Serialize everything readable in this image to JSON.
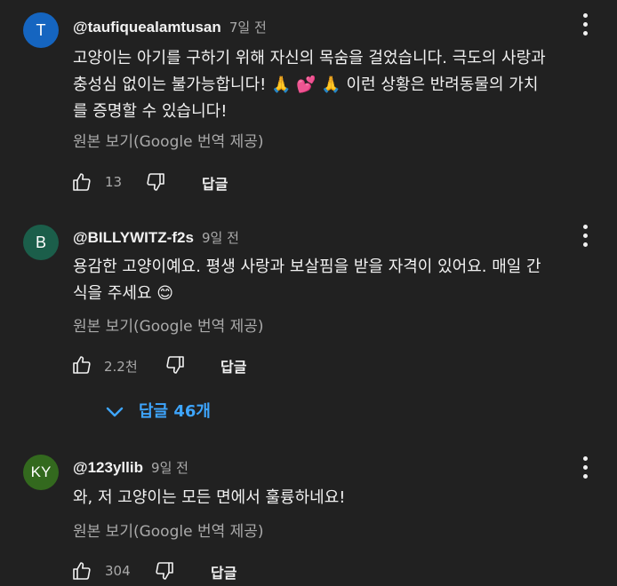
{
  "colors": {
    "background": "#212121",
    "text_primary": "#f1f1f1",
    "text_secondary": "#aaaaaa",
    "link_blue": "#3ea6ff"
  },
  "comments": [
    {
      "avatar_letter": "T",
      "avatar_color": "#1565c0",
      "handle": "@taufiquealamtusan",
      "time": "7일 전",
      "text_lines": [
        "고양이는 아기를 구하기 위해 자신의 목숨을 걸었습니다. 극도의 사랑과",
        "충성심 없이는 불가능합니다! 🙏 💕 🙏  이런 상황은 반려동물의 가치",
        "를 증명할 수 있습니다!"
      ],
      "translate_label": "원본 보기(Google 번역 제공)",
      "like_count": "13",
      "reply_label": "답글",
      "like_icon": "thumbs-up-icon",
      "dislike_icon": "thumbs-down-icon",
      "menu_icon": "more-vert-icon"
    },
    {
      "avatar_letter": "B",
      "avatar_color": "#1b5e4a",
      "handle": "@BILLYWITZ-f2s",
      "time": "9일 전",
      "text_lines": [
        "용감한 고양이예요. 평생 사랑과 보살핌을 받을 자격이 있어요. 매일 간",
        "식을 주세요 😊"
      ],
      "translate_label": "원본 보기(Google 번역 제공)",
      "like_count": "2.2천",
      "reply_label": "답글",
      "like_icon": "thumbs-up-icon",
      "dislike_icon": "thumbs-down-icon",
      "menu_icon": "more-vert-icon",
      "replies_toggle": "답글 46개"
    },
    {
      "avatar_letter": "KY",
      "avatar_color": "#33691e",
      "handle": "@123yllib",
      "time": "9일 전",
      "text_lines": [
        "와, 저 고양이는 모든 면에서 훌륭하네요!"
      ],
      "translate_label": "원본 보기(Google 번역 제공)",
      "like_count": "304",
      "reply_label": "답글",
      "like_icon": "thumbs-up-icon",
      "dislike_icon": "thumbs-down-icon",
      "menu_icon": "more-vert-icon"
    }
  ]
}
